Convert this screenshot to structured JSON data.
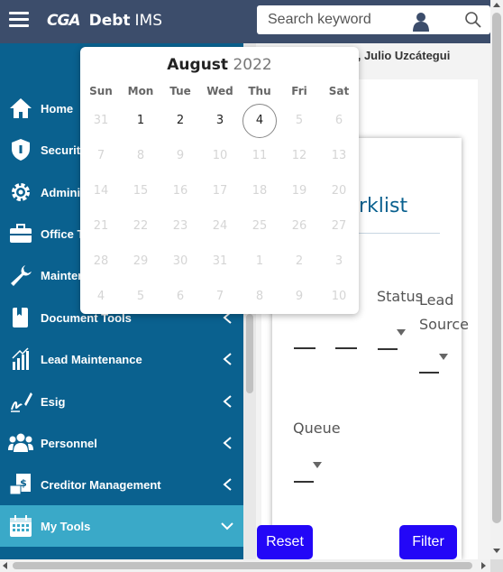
{
  "header": {
    "logo_mark": "CGA",
    "app_name_bold": "Debt",
    "app_name_rest": "IMS",
    "search_placeholder": "Search keyword"
  },
  "sidebar": {
    "items": [
      {
        "label": "Home",
        "icon": "home-icon"
      },
      {
        "label": "Security",
        "icon": "shield-icon"
      },
      {
        "label": "Adminis",
        "icon": "gear-icon"
      },
      {
        "label": "Office T",
        "icon": "briefcase-icon"
      },
      {
        "label": "Mainter",
        "icon": "wrench-icon"
      },
      {
        "label": "Document Tools",
        "icon": "document-icon"
      },
      {
        "label": "Lead Maintenance",
        "icon": "chart-icon"
      },
      {
        "label": "Esig",
        "icon": "signature-icon"
      },
      {
        "label": "Personnel",
        "icon": "people-icon"
      },
      {
        "label": "Creditor Management",
        "icon": "creditor-icon"
      },
      {
        "label": "My Tools",
        "icon": "calendar-icon"
      }
    ]
  },
  "main": {
    "welcome": "ome, Julio Uzcátegui",
    "card_title": "rklist",
    "status_label": "Status",
    "lead_source_label": "Lead Source",
    "queue_label": "Queue",
    "reset_label": "Reset",
    "filter_label": "Filter"
  },
  "datepicker": {
    "month": "August",
    "year": "2022",
    "weekdays": [
      "Sun",
      "Mon",
      "Tue",
      "Wed",
      "Thu",
      "Fri",
      "Sat"
    ],
    "weeks": [
      [
        "31",
        "1",
        "2",
        "3",
        "4",
        "5",
        "6"
      ],
      [
        "7",
        "8",
        "9",
        "10",
        "11",
        "12",
        "13"
      ],
      [
        "14",
        "15",
        "16",
        "17",
        "18",
        "19",
        "20"
      ],
      [
        "21",
        "22",
        "23",
        "24",
        "25",
        "26",
        "27"
      ],
      [
        "28",
        "29",
        "30",
        "31",
        "1",
        "2",
        "3"
      ],
      [
        "4",
        "5",
        "6",
        "7",
        "8",
        "9",
        "10"
      ]
    ],
    "today": "4"
  },
  "colors": {
    "topbar": "#3c4d6b",
    "sidebar": "#0a618f",
    "sidebar_active": "#3aa9c8",
    "button": "#2307f7",
    "title": "#0a618f"
  }
}
